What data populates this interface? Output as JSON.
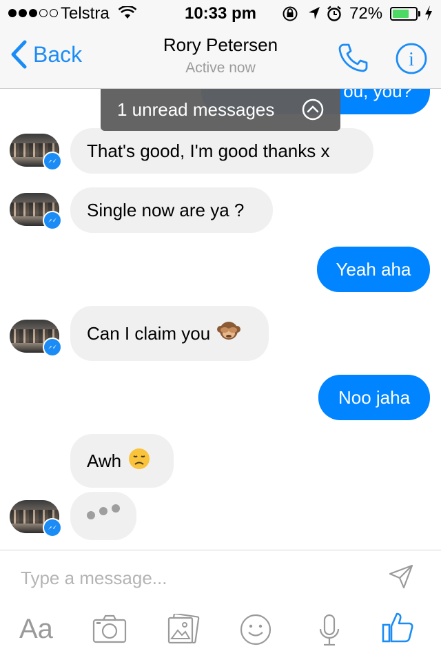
{
  "status_bar": {
    "carrier": "Telstra",
    "time": "10:33 pm",
    "battery_percent": "72%",
    "battery_level": 0.72,
    "signal_bars_filled": 3,
    "signal_bars_total": 5
  },
  "header": {
    "back_label": "Back",
    "contact_name": "Rory Petersen",
    "contact_status": "Active now",
    "call_icon": "phone-icon",
    "info_icon": "info-icon"
  },
  "unread_toast": {
    "text": "1 unread messages",
    "icon": "chevron-up-circle-icon"
  },
  "messages": [
    {
      "direction": "outgoing",
      "text": "ou, you?"
    },
    {
      "direction": "incoming",
      "text": "That's good, I'm good thanks x"
    },
    {
      "direction": "incoming",
      "text": "Single now are ya ?"
    },
    {
      "direction": "outgoing",
      "text": "Yeah aha"
    },
    {
      "direction": "incoming",
      "text": "Can I claim you",
      "emoji": "🙊"
    },
    {
      "direction": "outgoing",
      "text": "Noo jaha"
    },
    {
      "direction": "incoming",
      "text": "Awh",
      "emoji": "😞"
    }
  ],
  "composer": {
    "placeholder": "Type a message...",
    "aa_label": "Aa",
    "tools": [
      "text-format-icon",
      "camera-icon",
      "gallery-icon",
      "emoji-icon",
      "microphone-icon",
      "thumbs-up-icon"
    ]
  },
  "colors": {
    "accent": "#0084ff",
    "incoming_bubble": "#f0f0f0",
    "toast_bg": "#5f5f5f",
    "icon_gray": "#9a9a9a",
    "battery_green": "#4cd964"
  }
}
